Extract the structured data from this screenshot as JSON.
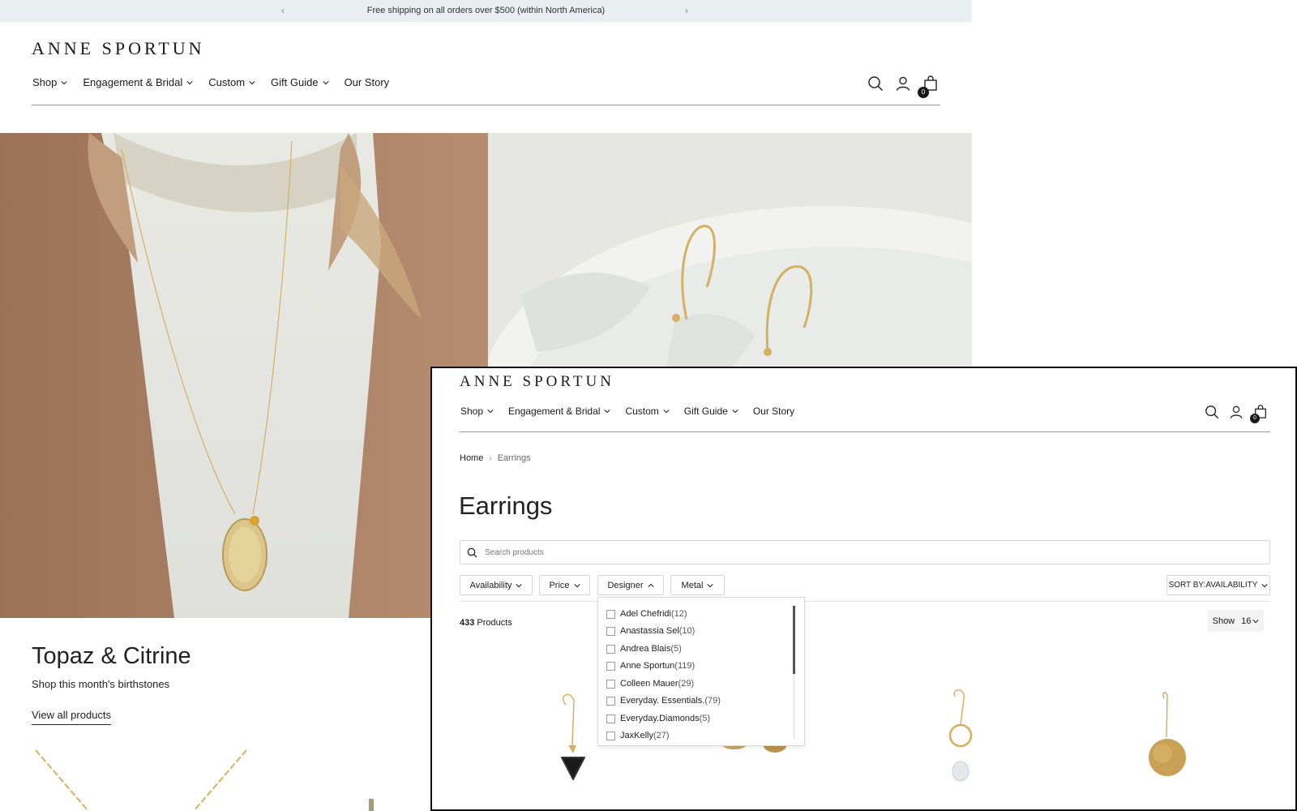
{
  "announcement": {
    "text": "Free shipping on all orders over $500 (within North America)"
  },
  "brand": {
    "logo": "ANNE SPORTUN"
  },
  "nav": {
    "items": [
      {
        "label": "Shop",
        "has_dropdown": true
      },
      {
        "label": "Engagement & Bridal",
        "has_dropdown": true
      },
      {
        "label": "Custom",
        "has_dropdown": true
      },
      {
        "label": "Gift Guide",
        "has_dropdown": true
      },
      {
        "label": "Our Story",
        "has_dropdown": false
      }
    ],
    "cart_count": "0"
  },
  "home": {
    "promo_title": "Topaz & Citrine",
    "promo_subtitle": "Shop this month's birthstones",
    "promo_link": "View all products"
  },
  "collection": {
    "breadcrumb": {
      "home": "Home",
      "current": "Earrings"
    },
    "title": "Earrings",
    "search_placeholder": "Search products",
    "filters": [
      "Availability",
      "Price",
      "Designer",
      "Metal"
    ],
    "sort_label": "SORT BY:AVAILABILITY",
    "product_count": "433",
    "products_label": "Products",
    "show_label": "Show",
    "show_value": "16",
    "designer_options": [
      {
        "name": "Adel Chefridi",
        "count": "(12)"
      },
      {
        "name": "Anastassia Sel",
        "count": "(10)"
      },
      {
        "name": "Andrea Blais",
        "count": "(5)"
      },
      {
        "name": "Anne Sportun",
        "count": "(119)"
      },
      {
        "name": "Colleen Mauer",
        "count": "(29)"
      },
      {
        "name": "Everyday. Essentials.",
        "count": "(79)"
      },
      {
        "name": "Everyday.Diamonds",
        "count": "(5)"
      },
      {
        "name": "JaxKelly",
        "count": "(27)"
      }
    ]
  },
  "colors": {
    "accent": "#1a1a1a",
    "announce_bg": "#e9eef1",
    "gold": "#d4b061"
  }
}
